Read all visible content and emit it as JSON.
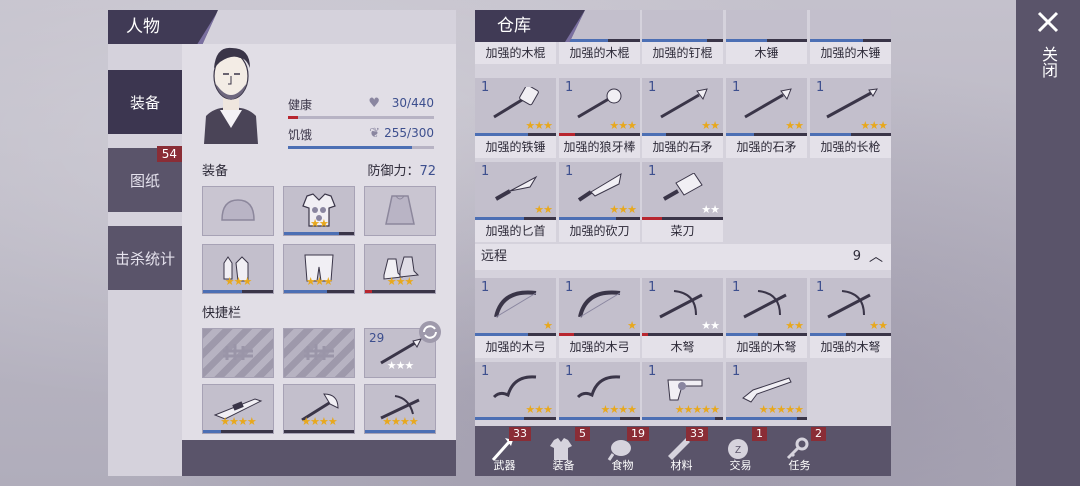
{
  "colors": {
    "accent": "#3c3650",
    "badge": "#8a2d36",
    "star": "#e8a81c",
    "bar_blue": "#4c6fb4",
    "bar_red": "#b8262f"
  },
  "character": {
    "title": "人物",
    "tabs": [
      {
        "label": "装备",
        "badge": ""
      },
      {
        "label": "图纸",
        "badge": "54"
      },
      {
        "label": "击杀统计",
        "badge": ""
      }
    ],
    "health": {
      "label": "健康",
      "value": "30/440",
      "fraction": 0.07
    },
    "hunger": {
      "label": "饥饿",
      "value": "255/300",
      "fraction": 0.85
    },
    "equipment": {
      "title": "装备",
      "defense_label": "防御力：",
      "defense_value": "72"
    },
    "quickbar": {
      "title": "快捷栏",
      "spear_count": "29"
    }
  },
  "warehouse": {
    "title": "仓库",
    "row0": [
      "加强的木棍",
      "加强的木棍",
      "加强的钉棍",
      "木锤",
      "加强的木锤"
    ],
    "melee": [
      {
        "qty": "1",
        "name": "加强的铁锤"
      },
      {
        "qty": "1",
        "name": "加强的狼牙棒"
      },
      {
        "qty": "1",
        "name": "加强的石矛"
      },
      {
        "qty": "1",
        "name": "加强的石矛"
      },
      {
        "qty": "1",
        "name": "加强的长枪"
      },
      {
        "qty": "1",
        "name": "加强的匕首"
      },
      {
        "qty": "1",
        "name": "加强的砍刀"
      },
      {
        "qty": "1",
        "name": "菜刀"
      }
    ],
    "ranged": {
      "title": "远程",
      "count": "9",
      "items": [
        {
          "qty": "1",
          "name": "加强的木弓"
        },
        {
          "qty": "1",
          "name": "加强的木弓"
        },
        {
          "qty": "1",
          "name": "木弩"
        },
        {
          "qty": "1",
          "name": "加强的木弩"
        },
        {
          "qty": "1",
          "name": "加强的木弩"
        },
        {
          "qty": "1",
          "name": ""
        },
        {
          "qty": "1",
          "name": ""
        },
        {
          "qty": "1",
          "name": ""
        },
        {
          "qty": "1",
          "name": ""
        }
      ]
    },
    "footer": [
      {
        "label": "武器",
        "badge": "33"
      },
      {
        "label": "装备",
        "badge": "5"
      },
      {
        "label": "食物",
        "badge": "19"
      },
      {
        "label": "材料",
        "badge": "33"
      },
      {
        "label": "交易",
        "badge": "1"
      },
      {
        "label": "任务",
        "badge": "2"
      }
    ]
  },
  "close": {
    "label": "关闭"
  }
}
